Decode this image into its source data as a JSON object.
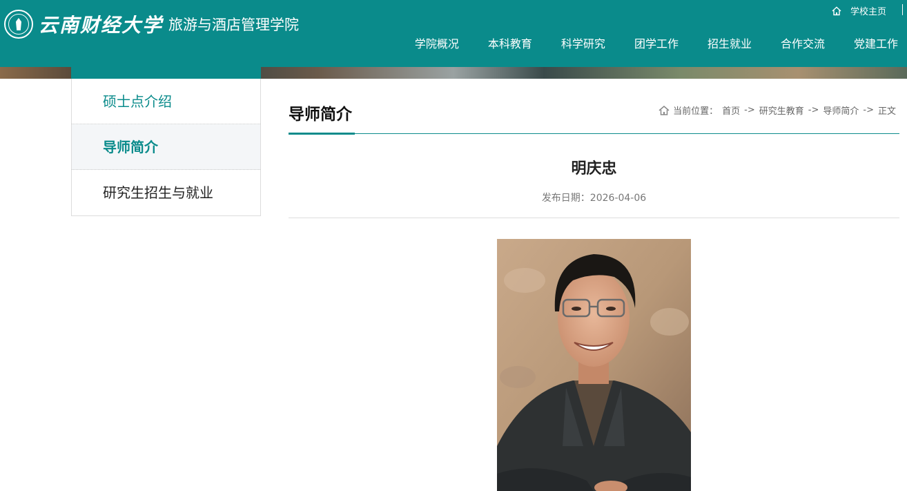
{
  "header": {
    "university_name": "云南财经大学",
    "college_name": "旅游与酒店管理学院",
    "home_link": "学校主页",
    "nav": [
      "学院概况",
      "本科教育",
      "科学研究",
      "团学工作",
      "招生就业",
      "合作交流",
      "党建工作"
    ]
  },
  "sidebar": {
    "items": [
      {
        "label": "硕士点介绍"
      },
      {
        "label": "导师简介"
      },
      {
        "label": "研究生招生与就业"
      }
    ]
  },
  "content": {
    "section_title": "导师简介",
    "breadcrumb": {
      "prefix": "当前位置：",
      "items": [
        "首页",
        "研究生教育",
        "导师简介",
        "正文"
      ],
      "separator": "->"
    },
    "article": {
      "title": "明庆忠",
      "date_label": "发布日期：2026-04-06"
    }
  },
  "colors": {
    "accent": "#0a8b8b",
    "sidebar_active_bg": "#f4f6f8"
  }
}
